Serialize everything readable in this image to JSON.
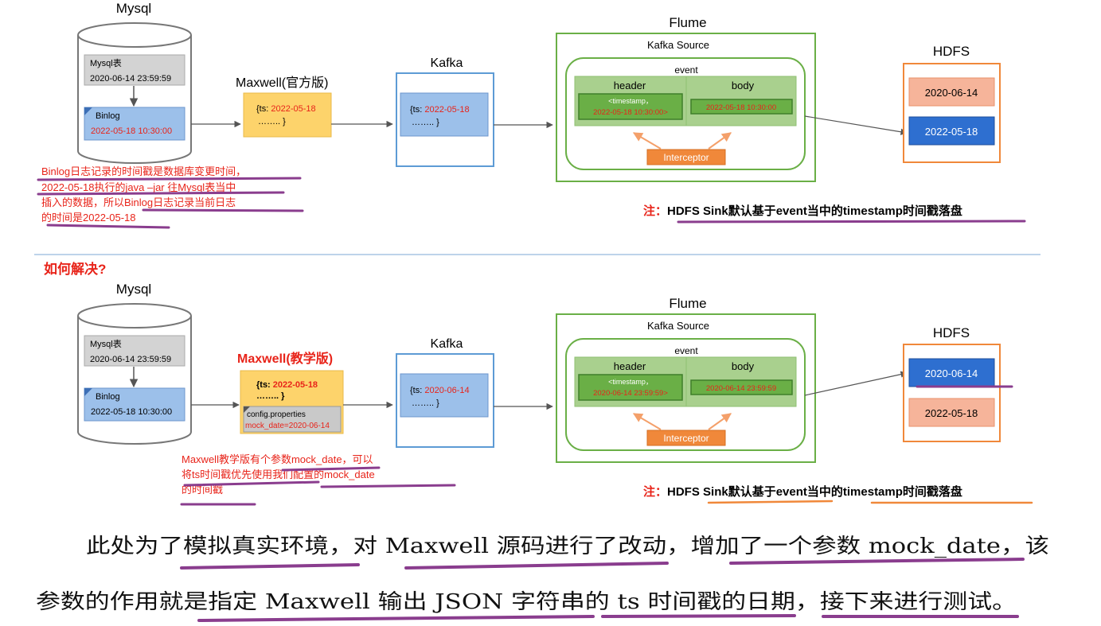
{
  "top": {
    "mysql_title": "Mysql",
    "mysql_table_label": "Mysql表",
    "mysql_table_time": "2020-06-14 23:59:59",
    "binlog_label": "Binlog",
    "binlog_time": "2022-05-18 10:30:00",
    "maxwell_title": "Maxwell(官方版)",
    "maxwell_ts_label": "{ts: ",
    "maxwell_ts_value": "2022-05-18",
    "maxwell_ts_end": "……..      }",
    "kafka_title": "Kafka",
    "kafka_ts_label": "{ts: ",
    "kafka_ts_value": "2022-05-18",
    "kafka_ts_end": "……..      }",
    "flume_title": "Flume",
    "kafka_source": "Kafka Source",
    "event": "event",
    "header": "header",
    "body": "body",
    "timestamp_tag": "<timestamp，",
    "header_time": "2022-05-18 10:30:00>",
    "body_time": "2022-05-18 10:30:00",
    "interceptor": "Interceptor",
    "hdfs_title": "HDFS",
    "hdfs_dir1": "2020-06-14",
    "hdfs_dir2": "2022-05-18",
    "note_prefix": "注：",
    "note_text": "HDFS Sink默认基于event当中的timestamp时间戳落盘",
    "binlog_note_lines": [
      "Binlog日志记录的时间戳是数据库变更时间，",
      "2022-05-18执行的java –jar 往Mysql表当中",
      "插入的数据，所以Binlog日志记录当前日志",
      "的时间是2022-05-18"
    ]
  },
  "question": "如何解决?",
  "bottom": {
    "mysql_title": "Mysql",
    "mysql_table_label": "Mysql表",
    "mysql_table_time": "2020-06-14 23:59:59",
    "binlog_label": "Binlog",
    "binlog_time": "2022-05-18 10:30:00",
    "maxwell_title": "Maxwell(教学版)",
    "maxwell_ts_label": "{ts: ",
    "maxwell_ts_value": "2022-05-18",
    "maxwell_ts_end": "……..      }",
    "config_label": "config.properties",
    "config_value": "mock_date=2020-06-14",
    "kafka_title": "Kafka",
    "kafka_ts_label": "{ts: ",
    "kafka_ts_value": "2020-06-14",
    "kafka_ts_end": "……..      }",
    "flume_title": "Flume",
    "kafka_source": "Kafka Source",
    "event": "event",
    "header": "header",
    "body": "body",
    "timestamp_tag": "<timestamp，",
    "header_time": "2020-06-14 23:59:59>",
    "body_time": "2020-06-14 23:59:59",
    "interceptor": "Interceptor",
    "hdfs_title": "HDFS",
    "hdfs_dir1": "2020-06-14",
    "hdfs_dir2": "2022-05-18",
    "note_prefix": "注：",
    "note_text": "HDFS Sink默认基于event当中的timestamp时间戳落盘",
    "mock_note_lines": [
      "Maxwell教学版有个参数mock_date，可以",
      "将ts时间戳优先使用我们配置的mock_date",
      "的时间戳"
    ]
  },
  "paragraph_lines": [
    "此处为了模拟真实环境，对 Maxwell 源码进行了改动，增加了一个参数 mock_date，该",
    "参数的作用就是指定 Maxwell 输出 JSON 字符串的 ts 时间戳的日期，接下来进行测试。"
  ],
  "colors": {
    "red": "#e8241a",
    "blue_fill": "#9cc0ea",
    "dark_blue": "#2e6fd0",
    "salmon": "#f6b49a",
    "orange": "#f0883a",
    "green_border": "#6aaf46",
    "green_fill": "#a9d08e",
    "yellow": "#fdd36b",
    "purple": "#8a3d8e"
  }
}
